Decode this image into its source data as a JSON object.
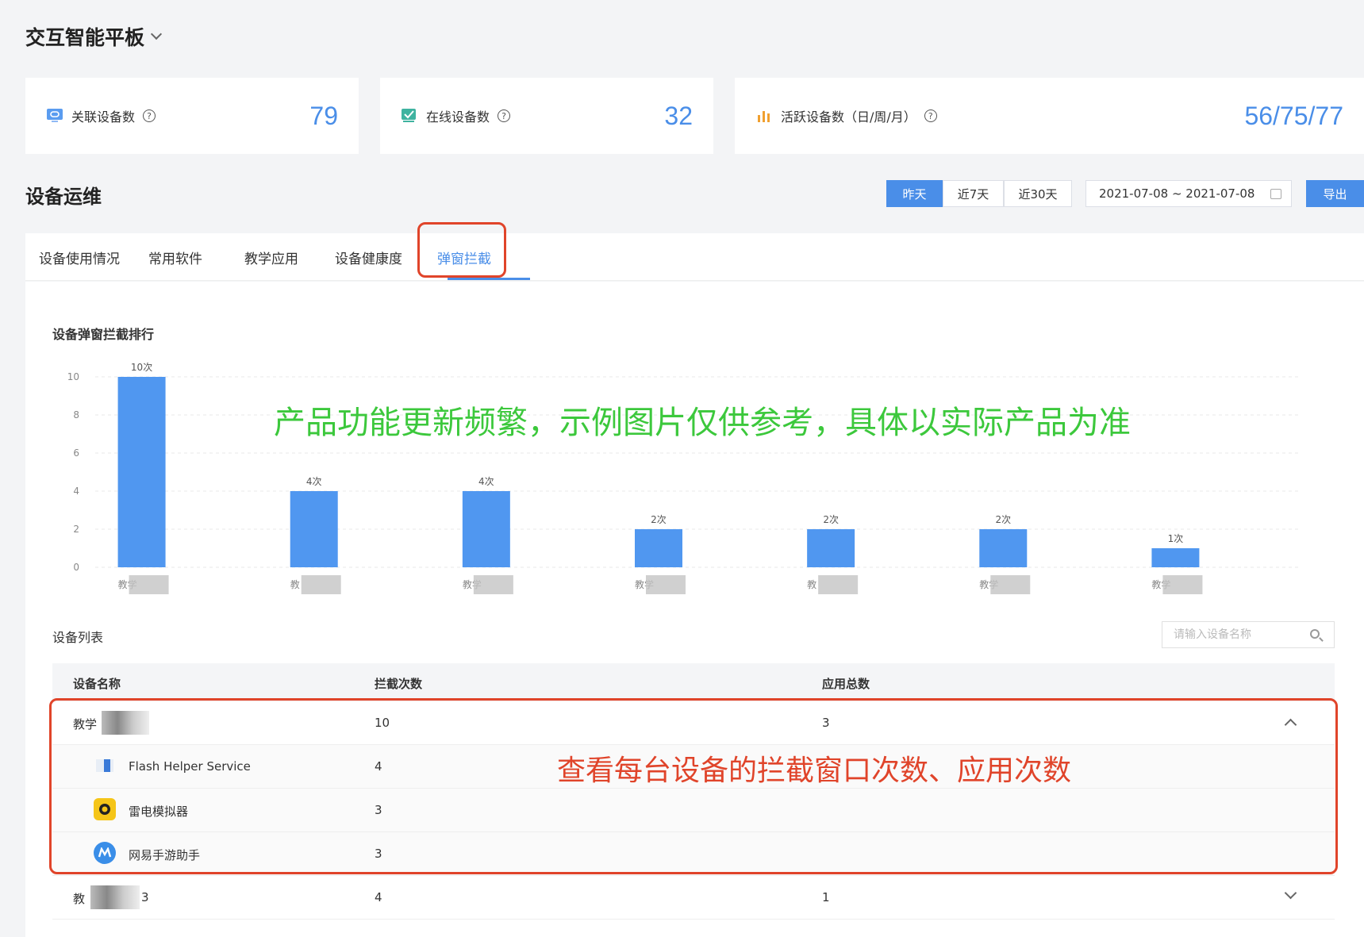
{
  "header": {
    "title": "交互智能平板"
  },
  "stats": [
    {
      "label": "关联设备数",
      "value": "79",
      "icon": "link-device-icon"
    },
    {
      "label": "在线设备数",
      "value": "32",
      "icon": "check-box-icon"
    },
    {
      "label": "活跃设备数（日/周/月）",
      "value": "56/75/77",
      "icon": "bar-chart-icon"
    }
  ],
  "ops": {
    "title": "设备运维",
    "ranges": [
      "昨天",
      "近7天",
      "近30天"
    ],
    "active_range": 0,
    "date_range": "2021-07-08 ~ 2021-07-08",
    "export_label": "导出"
  },
  "tabs": [
    {
      "label": "设备使用情况"
    },
    {
      "label": "常用软件"
    },
    {
      "label": "教学应用"
    },
    {
      "label": "设备健康度"
    },
    {
      "label": "弹窗拦截"
    }
  ],
  "active_tab": 4,
  "chart_data": {
    "type": "bar",
    "title": "设备弹窗拦截排行",
    "categories": [
      "教学",
      "教",
      "教学",
      "教学",
      "教",
      "教学",
      "教学"
    ],
    "values": [
      10,
      4,
      4,
      2,
      2,
      2,
      1
    ],
    "data_labels": [
      "10次",
      "4次",
      "4次",
      "2次",
      "2次",
      "2次",
      "1次"
    ],
    "ylim": [
      0,
      10
    ],
    "yticks": [
      0,
      2,
      4,
      6,
      8,
      10
    ],
    "grid": true,
    "bar_color": "#5097f0"
  },
  "overlay_note": "产品功能更新频繁，示例图片仅供参考，具体以实际产品为准",
  "device_list": {
    "title": "设备列表",
    "search_placeholder": "请输入设备名称",
    "columns": [
      "设备名称",
      "拦截次数",
      "应用总数"
    ],
    "rows": [
      {
        "name": "教学",
        "blocked": "10",
        "apps": "3",
        "expanded": true,
        "children": [
          {
            "name": "Flash Helper Service",
            "blocked": "4",
            "icon": "flash-helper-icon"
          },
          {
            "name": "雷电模拟器",
            "blocked": "3",
            "icon": "leidian-emulator-icon"
          },
          {
            "name": "网易手游助手",
            "blocked": "3",
            "icon": "netease-assistant-icon"
          }
        ]
      },
      {
        "name": "教",
        "suffix": "3",
        "blocked": "4",
        "apps": "1",
        "expanded": false
      }
    ]
  },
  "row_note": "查看每台设备的拦截窗口次数、应用次数"
}
